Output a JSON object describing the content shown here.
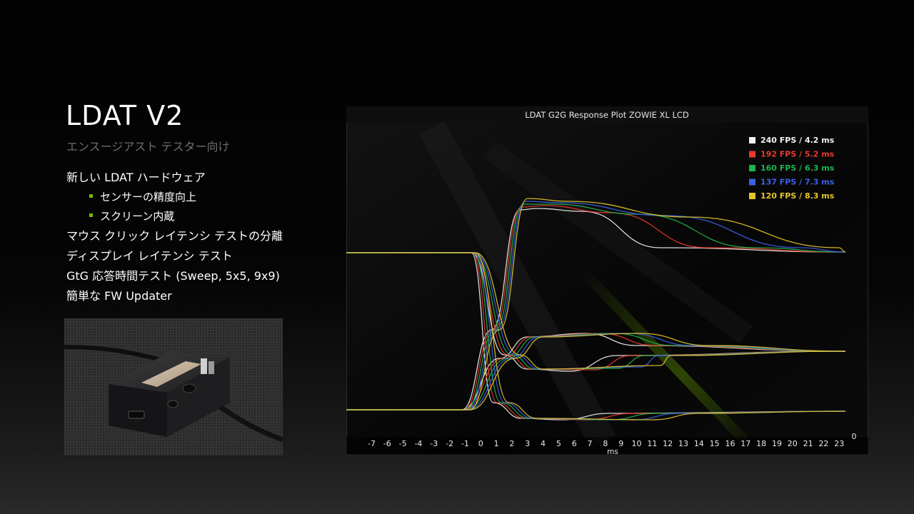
{
  "slide": {
    "title": "LDAT V2",
    "subtitle": "エンスージアスト テスター向け",
    "bullets": [
      {
        "text": "新しい LDAT ハードウェア",
        "level": 0
      },
      {
        "text": "センサーの精度向上",
        "level": 1
      },
      {
        "text": "スクリーン内蔵",
        "level": 1
      },
      {
        "text": "マウス クリック レイテンシ テストの分離",
        "level": 0
      },
      {
        "text": "ディスプレイ レイテンシ テスト",
        "level": 0
      },
      {
        "text": "GtG 応答時間テスト (Sweep, 5x5, 9x9)",
        "level": 0
      },
      {
        "text": "簡単な FW Updater",
        "level": 0
      }
    ],
    "accent_color": "#76b900"
  },
  "chart_data": {
    "type": "line",
    "title": "LDAT G2G Response Plot ZOWIE XL LCD",
    "xlabel": "ms",
    "x_ticks": [
      -7,
      -6,
      -5,
      -4,
      -3,
      -2,
      -1,
      0,
      1,
      2,
      3,
      4,
      5,
      6,
      7,
      8,
      9,
      10,
      11,
      12,
      13,
      14,
      15,
      16,
      17,
      18,
      19,
      20,
      21,
      22,
      23
    ],
    "xlim": [
      -7.8,
      23.4
    ],
    "y_corner_label": "0",
    "legend_position": "top-right",
    "series": [
      {
        "name": "240 FPS / 4.2 ms",
        "color": "#f2f2f2"
      },
      {
        "name": "192 FPS / 5.2 ms",
        "color": "#e83a2e"
      },
      {
        "name": "160 FPS / 6.3 ms",
        "color": "#1fb24e"
      },
      {
        "name": "137 FPS / 7.3 ms",
        "color": "#3a62e8"
      },
      {
        "name": "120 FPS / 8.3 ms",
        "color": "#e6c62a"
      }
    ]
  }
}
